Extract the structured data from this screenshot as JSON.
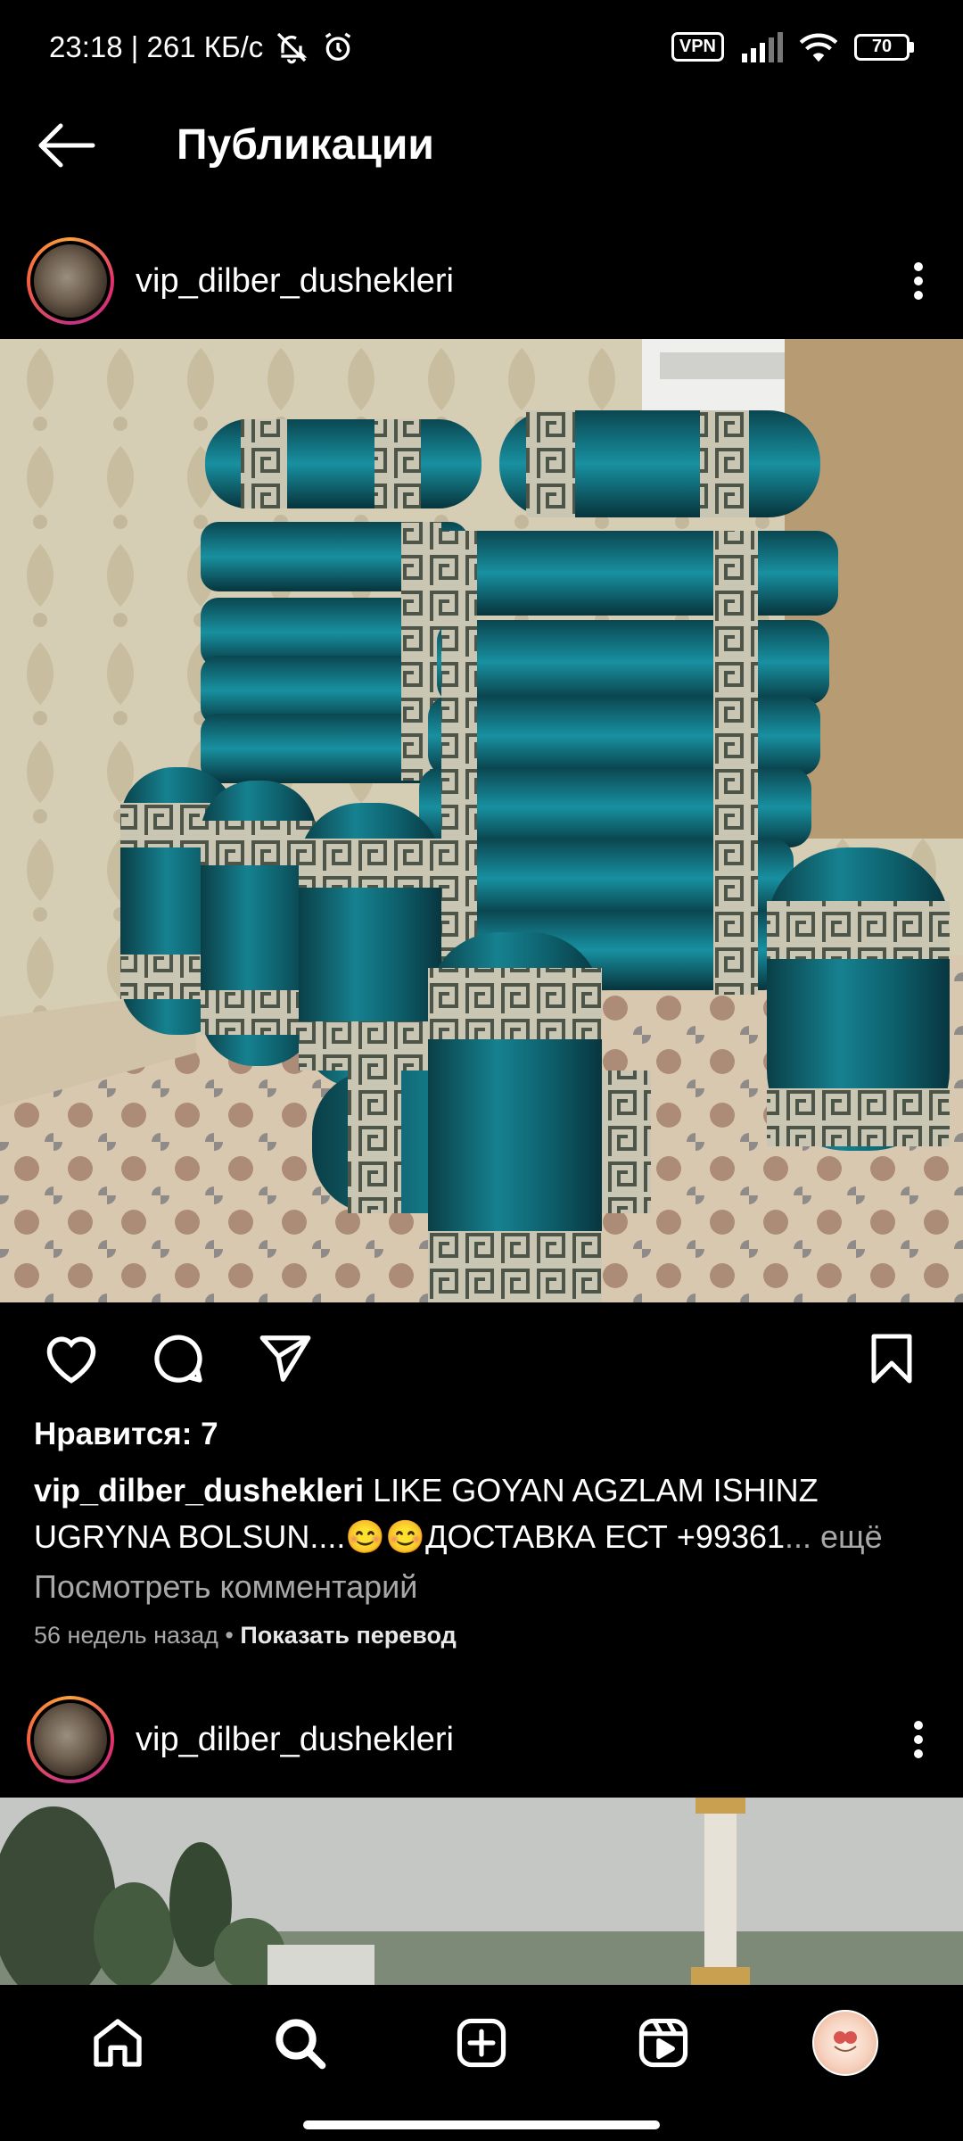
{
  "status_bar": {
    "time_speed": "23:18 | 261 КБ/с",
    "vpn": "VPN",
    "battery": "70",
    "icons": [
      "mute-bell-icon",
      "alarm-icon",
      "signal-icon",
      "wifi-icon",
      "battery-icon"
    ]
  },
  "header": {
    "title": "Публикации",
    "back_icon": "arrow-left-icon"
  },
  "post1": {
    "username": "vip_dilber_dushekleri",
    "likes": "Нравится: 7",
    "caption_user": "vip_dilber_dushekleri",
    "caption_text": " LIKE GOYAN AGZLAM ISHINZ UGRYNA BOLSUN....😊😊ДОСТАВКА ЕСТ +99361",
    "caption_more": "... ещё",
    "view_comments": "Посмотреть комментарий",
    "time_ago": "56 недель назад",
    "separator": " • ",
    "translate": "Показать перевод",
    "image_icon": "teal-velvet-cushions-photo"
  },
  "post2": {
    "username": "vip_dilber_dushekleri",
    "image_icon": "park-with-column-photo"
  },
  "actions": {
    "like_icon": "heart-icon",
    "comment_icon": "comment-bubble-icon",
    "share_icon": "paper-plane-icon",
    "save_icon": "bookmark-icon"
  },
  "bottom_nav": {
    "items": [
      "home-icon",
      "search-icon",
      "create-post-icon",
      "reels-icon",
      "profile-avatar"
    ]
  },
  "colors": {
    "background": "#000000",
    "text": "#ffffff",
    "secondary_text": "#a8a8a8",
    "cushion_teal": "#0f5f6a"
  }
}
